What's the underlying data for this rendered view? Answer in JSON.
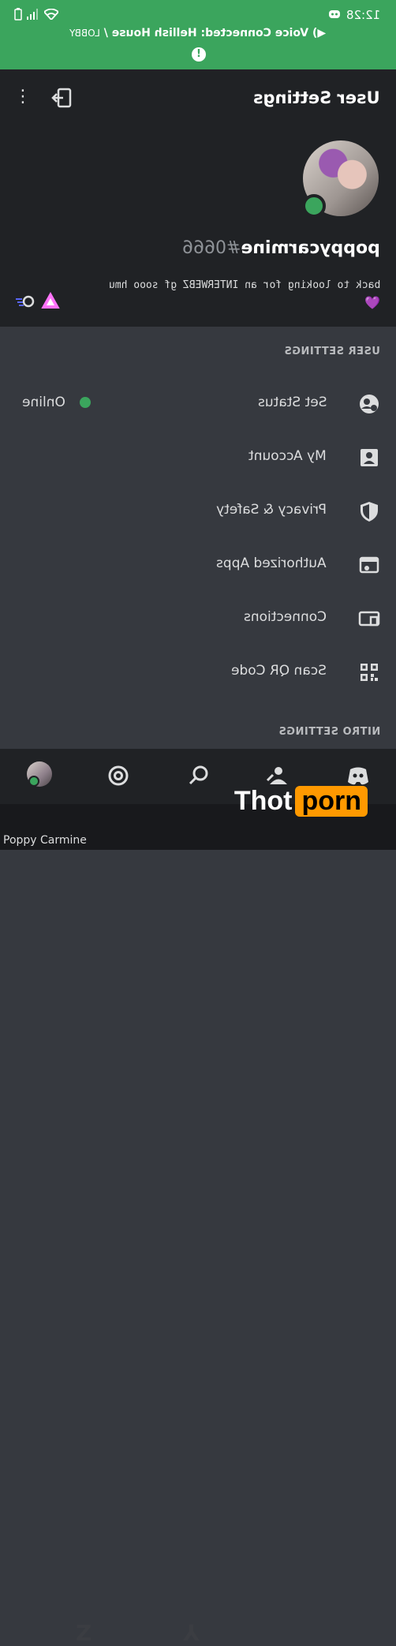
{
  "status": {
    "time": "12:28"
  },
  "voice_banner": {
    "prefix": "Voice Connected: Hellish House /",
    "channel": "LOBBY",
    "warning": "!"
  },
  "header": {
    "title": "User Settings"
  },
  "profile": {
    "username": "poppycarmine",
    "discriminator": "#0666",
    "bio": "back to looking for an INTERWEBZ gf sooo hmu",
    "heart": "💜"
  },
  "sections": {
    "user_settings": "USER SETTINGS",
    "nitro_settings": "NITRO SETTINGS"
  },
  "rows": [
    {
      "label": "Set Status",
      "value": "Online",
      "icon": "status-icon"
    },
    {
      "label": "My Account",
      "icon": "account-icon"
    },
    {
      "label": "Privacy & Safety",
      "icon": "shield-icon"
    },
    {
      "label": "Authorized Apps",
      "icon": "apps-icon"
    },
    {
      "label": "Connections",
      "icon": "connections-icon"
    },
    {
      "label": "Scan QR Code",
      "icon": "qr-code-icon"
    }
  ],
  "footer": {
    "user": "Poppy Carmine"
  },
  "watermark": {
    "left": "Thot",
    "right": "porn"
  },
  "colors": {
    "green": "#3ba55d",
    "bg": "#36393f",
    "dark": "#202225"
  }
}
